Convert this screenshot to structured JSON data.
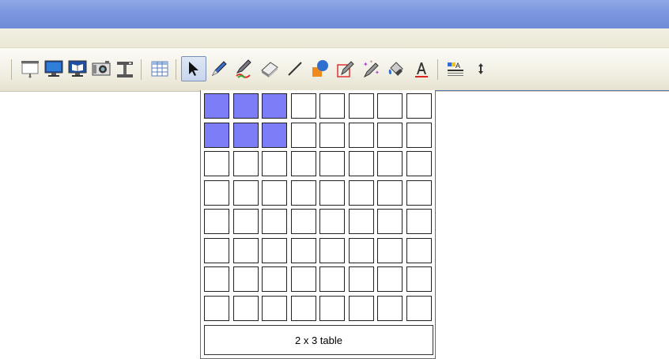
{
  "toolbar": {
    "tools": [
      {
        "name": "screen-projector-icon"
      },
      {
        "name": "monitor-icon"
      },
      {
        "name": "book-display-icon"
      },
      {
        "name": "camera-icon"
      },
      {
        "name": "document-camera-icon"
      },
      {
        "name": "insert-table-icon"
      },
      {
        "name": "select-arrow-icon"
      },
      {
        "name": "pen-icon"
      },
      {
        "name": "creative-pen-icon"
      },
      {
        "name": "eraser-icon"
      },
      {
        "name": "line-icon"
      },
      {
        "name": "shapes-icon"
      },
      {
        "name": "shape-pen-icon"
      },
      {
        "name": "magic-pen-icon"
      },
      {
        "name": "fill-bucket-icon"
      },
      {
        "name": "text-icon"
      },
      {
        "name": "properties-icon"
      },
      {
        "name": "move-toolbar-icon"
      }
    ]
  },
  "table_picker": {
    "columns": 8,
    "rows": 8,
    "selected_rows": 2,
    "selected_columns": 3,
    "label": "2 x 3 table",
    "selected_color": "#7d7df7"
  }
}
